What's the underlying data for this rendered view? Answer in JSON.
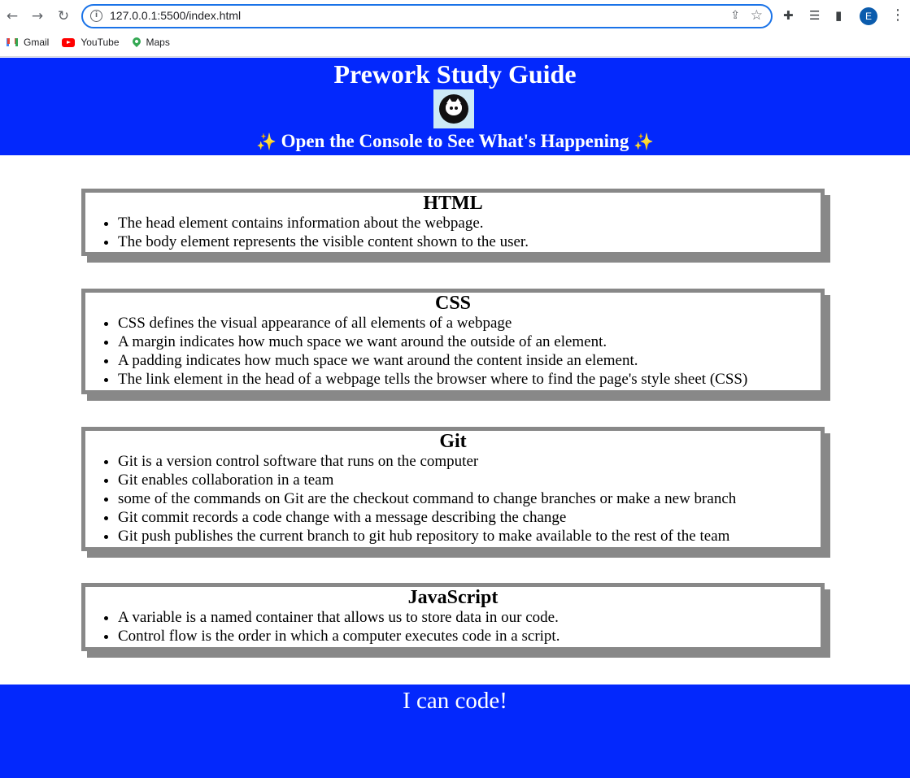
{
  "browser": {
    "url": "127.0.0.1:5500/index.html",
    "profile_initial": "E",
    "bookmarks": [
      {
        "label": "Gmail",
        "icon": "gmail-icon"
      },
      {
        "label": "YouTube",
        "icon": "youtube-icon"
      },
      {
        "label": "Maps",
        "icon": "maps-icon"
      }
    ]
  },
  "header": {
    "title": "Prework Study Guide",
    "subtitle": "Open the Console to See What's Happening",
    "sparkle": "✨",
    "background_color": "#0328fc"
  },
  "sections": [
    {
      "title": "HTML",
      "items": [
        "The head element contains information about the webpage.",
        "The body element represents the visible content shown to the user."
      ]
    },
    {
      "title": "CSS",
      "items": [
        "CSS defines the visual appearance of all elements of a webpage",
        "A margin indicates how much space we want around the outside of an element.",
        "A padding indicates how much space we want around the content inside an element.",
        "The link element in the head of a webpage tells the browser where to find the page's style sheet (CSS)"
      ]
    },
    {
      "title": "Git",
      "items": [
        "Git is a version control software that runs on the computer",
        "Git enables collaboration in a team",
        "some of the commands on Git are the checkout command to change branches or make a new branch",
        "Git commit records a code change with a message describing the change",
        "Git push publishes the current branch to git hub repository to make available to the rest of the team"
      ]
    },
    {
      "title": "JavaScript",
      "items": [
        "A variable is a named container that allows us to store data in our code.",
        "Control flow is the order in which a computer executes code in a script."
      ]
    }
  ],
  "footer": {
    "text": "I can code!"
  }
}
